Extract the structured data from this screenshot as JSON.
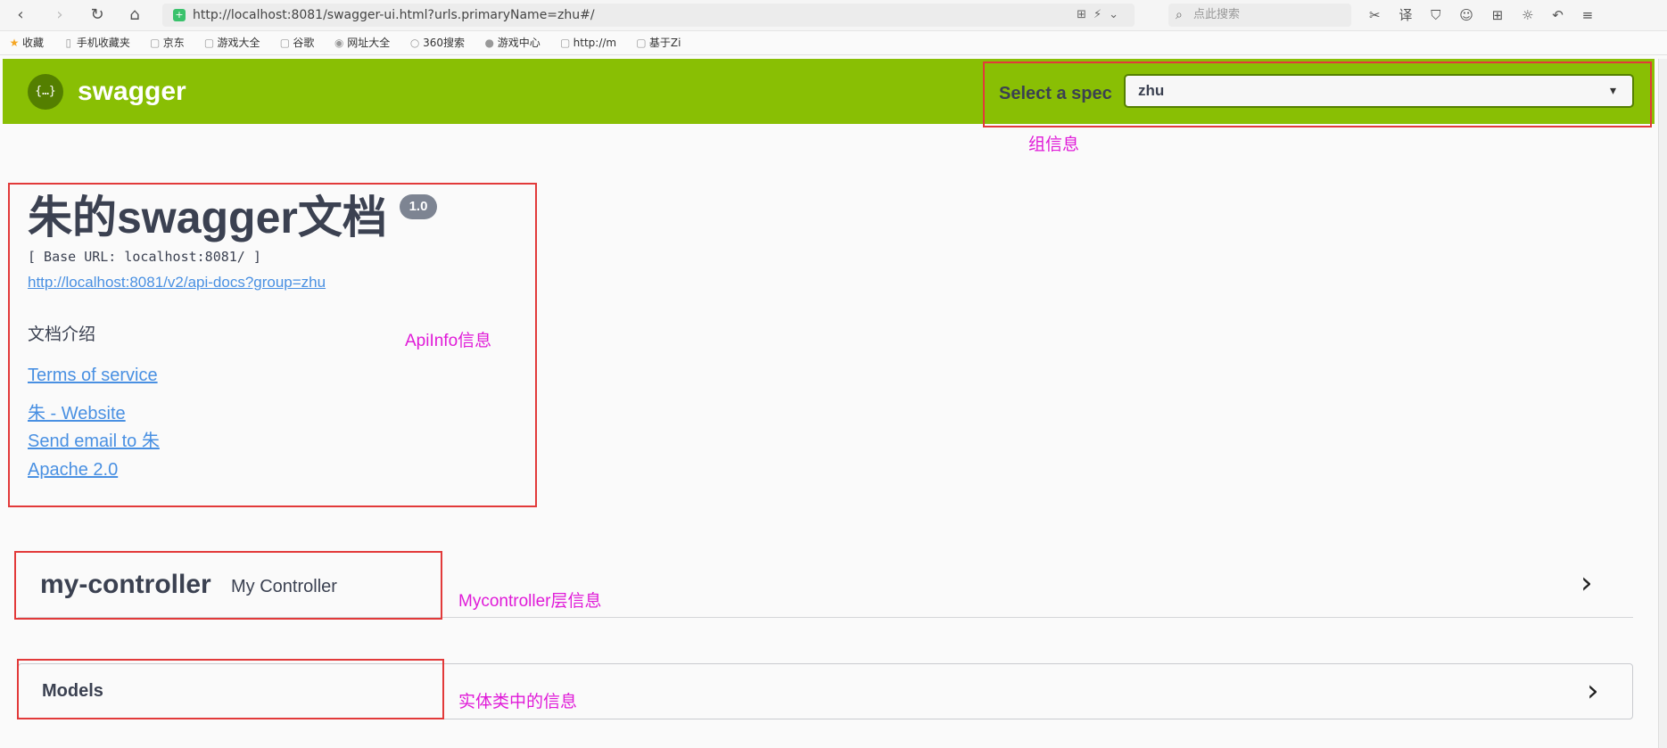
{
  "browser": {
    "url": "http://localhost:8081/swagger-ui.html?urls.primaryName=zhu#/",
    "search_placeholder": "点此搜索",
    "bookmarks": [
      "收藏",
      "手机收藏夹",
      "京东",
      "游戏大全",
      "谷歌",
      "网址大全",
      "360搜索",
      "游戏中心",
      "http://m",
      "基于Zi"
    ]
  },
  "topbar": {
    "logo_glyph": "{…}",
    "title": "swagger",
    "spec_label": "Select a spec",
    "spec_value": "zhu",
    "accent_color": "#89bf04"
  },
  "info": {
    "title": "朱的swagger文档",
    "version": "1.0",
    "base_url": "[ Base URL: localhost:8081/ ]",
    "api_docs_link": "http://localhost:8081/v2/api-docs?group=zhu",
    "description": "文档介绍",
    "terms": "Terms of service",
    "website": "朱 - Website",
    "email": "Send email to 朱",
    "license": "Apache 2.0"
  },
  "tag": {
    "name": "my-controller",
    "description": "My Controller"
  },
  "models": {
    "title": "Models"
  },
  "annotations": {
    "group": "组信息",
    "apiinfo": "ApiInfo信息",
    "controller": "Mycontroller层信息",
    "entity": "实体类中的信息",
    "color": "#e01bd8",
    "box_color": "#e23a3a"
  }
}
